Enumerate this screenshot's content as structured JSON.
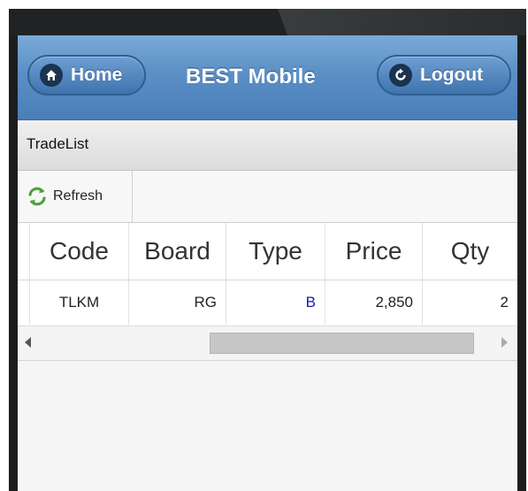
{
  "header": {
    "home_label": "Home",
    "title": "BEST Mobile",
    "logout_label": "Logout"
  },
  "section": {
    "title": "TradeList"
  },
  "toolbar": {
    "refresh_label": "Refresh"
  },
  "grid": {
    "columns": [
      "",
      "Code",
      "Board",
      "Type",
      "Price",
      "Qty"
    ],
    "rows": [
      [
        "",
        "TLKM",
        "RG",
        "B",
        "2,850",
        "2"
      ]
    ]
  },
  "colors": {
    "header_blue": "#5b8fc5",
    "type_buy": "#1a1ab3"
  },
  "icons": {
    "home": "home-icon",
    "logout": "logout-icon",
    "refresh": "refresh-icon"
  }
}
